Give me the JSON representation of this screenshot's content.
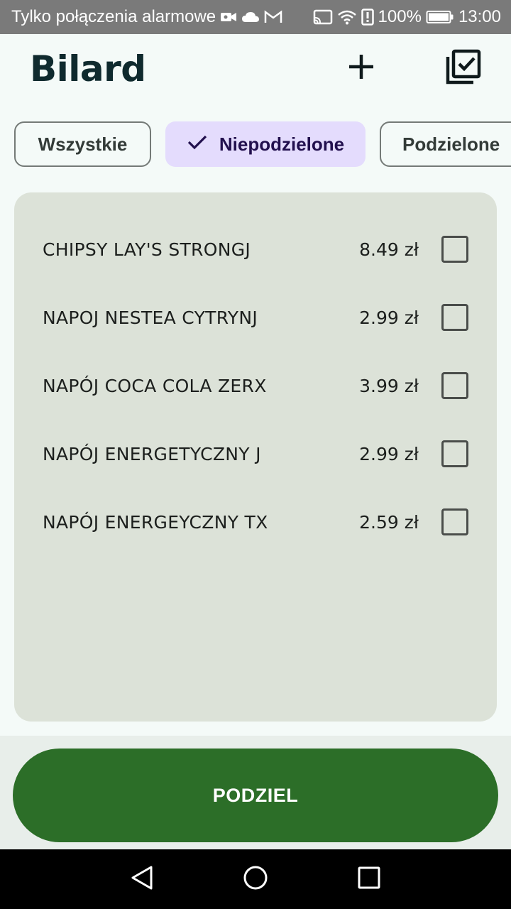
{
  "status_bar": {
    "carrier_text": "Tylko połączenia alarmowe",
    "battery": "100%",
    "time": "13:00",
    "icons_left": [
      "video-icon",
      "cloud-icon",
      "gmail-icon"
    ],
    "icons_right": [
      "cast-icon",
      "wifi-icon",
      "alert-icon",
      "battery-icon"
    ]
  },
  "app_bar": {
    "title": "Bilard",
    "actions": [
      "add-icon",
      "select-all-icon"
    ]
  },
  "filters": {
    "all": "Wszystkie",
    "undivided": "Niepodzielone",
    "divided": "Podzielone",
    "selected": "undivided"
  },
  "items": [
    {
      "name": "CHIPSY LAY'S STRONGJ",
      "price": "8.49 zł",
      "checked": false
    },
    {
      "name": "NAPOJ NESTEA CYTRYNJ",
      "price": "2.99 zł",
      "checked": false
    },
    {
      "name": "NAPÓJ COCA COLA ZERX",
      "price": "3.99 zł",
      "checked": false
    },
    {
      "name": "NAPÓJ ENERGETYCZNY J",
      "price": "2.99 zł",
      "checked": false
    },
    {
      "name": "NAPÓJ ENERGEYCZNY TX",
      "price": "2.59 zł",
      "checked": false
    }
  ],
  "actions": {
    "split_label": "PODZIEL"
  },
  "colors": {
    "primary": "#2c6e28",
    "chip_selected_bg": "#e4dcfd",
    "card_bg": "#dce2d8",
    "background": "#f4faf8"
  },
  "nav_bar": [
    "back-icon",
    "home-icon",
    "recents-icon"
  ]
}
